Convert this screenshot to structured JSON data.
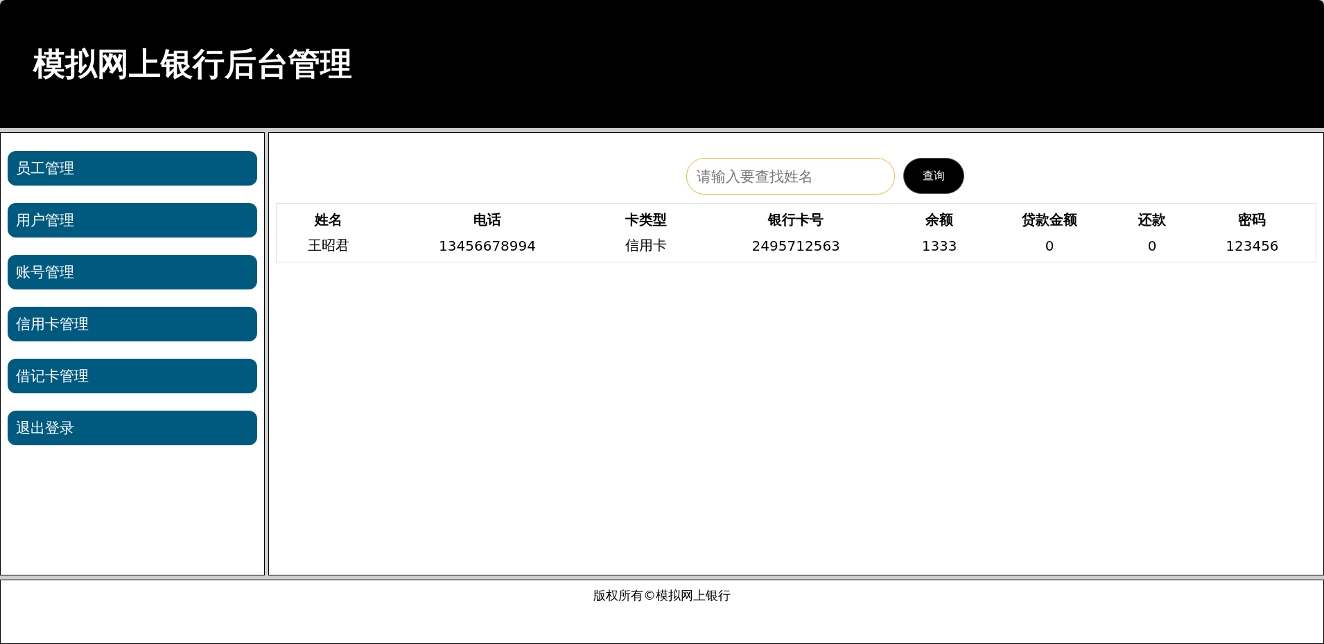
{
  "header": {
    "title": "模拟网上银行后台管理"
  },
  "sidebar": {
    "items": [
      {
        "label": "员工管理"
      },
      {
        "label": "用户管理"
      },
      {
        "label": "账号管理"
      },
      {
        "label": "信用卡管理"
      },
      {
        "label": "借记卡管理"
      },
      {
        "label": "退出登录"
      }
    ]
  },
  "search": {
    "placeholder": "请输入要查找姓名",
    "button": "查询"
  },
  "table": {
    "columns": [
      "姓名",
      "电话",
      "卡类型",
      "银行卡号",
      "余额",
      "贷款金额",
      "还款",
      "密码"
    ],
    "rows": [
      [
        "王昭君",
        "13456678994",
        "信用卡",
        "2495712563",
        "1333",
        "0",
        "0",
        "123456"
      ]
    ]
  },
  "footer": {
    "text": "版权所有©模拟网上银行"
  }
}
